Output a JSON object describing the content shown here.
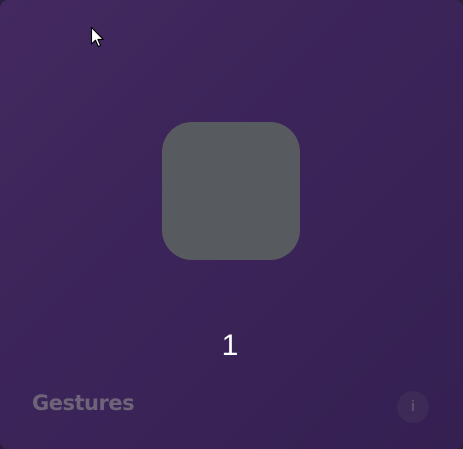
{
  "tile": {
    "number": "1"
  },
  "footer": {
    "title": "Gestures",
    "info_glyph": "i"
  },
  "icons": {
    "info": "info-icon",
    "cursor": "mouse-pointer-icon"
  },
  "colors": {
    "background": "#3b2459",
    "tile": "#575a5f",
    "footer_text": "#6e6378"
  }
}
